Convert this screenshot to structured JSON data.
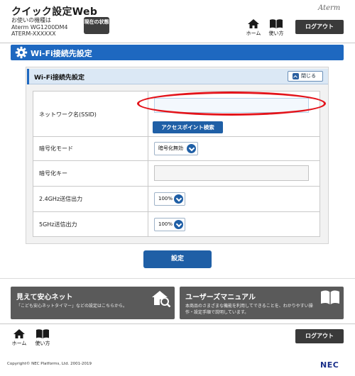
{
  "header": {
    "app_title": "クイック設定Web",
    "device_label": "お使いの機種は",
    "model": "Aterm WG1200DM4",
    "serial": "ATERM-XXXXXX",
    "status_button": "現在の状態",
    "brand": "Aterm",
    "home_label": "ホーム",
    "usage_label": "使い方",
    "logout_label": "ログアウト"
  },
  "section": {
    "title": "Wi-Fi接続先設定",
    "icon": "gear-icon"
  },
  "panel": {
    "title": "Wi-Fi接続先設定",
    "close_label": "閉じる"
  },
  "form": {
    "ssid_label": "ネットワーク名(SSID)",
    "ssid_value": "",
    "ap_search_label": "アクセスポイント検索",
    "encryption_mode_label": "暗号化モード",
    "encryption_mode_value": "暗号化無効",
    "encryption_key_label": "暗号化キー",
    "encryption_key_value": "",
    "power_24_label": "2.4GHz送信出力",
    "power_24_value": "100%",
    "power_5_label": "5GHz送信出力",
    "power_5_value": "100%"
  },
  "actions": {
    "submit_label": "設定"
  },
  "promos": [
    {
      "title": "見えて安心ネット",
      "desc": "「こども安心ネットタイマー」などの設定はこちらから。",
      "icon": "house-search-icon"
    },
    {
      "title": "ユーザーズマニュアル",
      "desc1": "本商品のさまざまな機能を利用してできることを、わかりやすい操",
      "desc2": "作・設定手順で説明しています。",
      "icon": "book-icon"
    }
  ],
  "footer": {
    "home_label": "ホーム",
    "usage_label": "使い方",
    "logout_label": "ログアウト",
    "copyright": "Copyright© NEC Platforms, Ltd. 2001-2019",
    "logo": "NEC"
  },
  "colors": {
    "accent": "#1e68c0",
    "button_blue": "#1f5fa6",
    "annotation_red": "#e3141b",
    "dark_button": "#3a3a3a",
    "promo_bg": "#5a5a5a"
  }
}
